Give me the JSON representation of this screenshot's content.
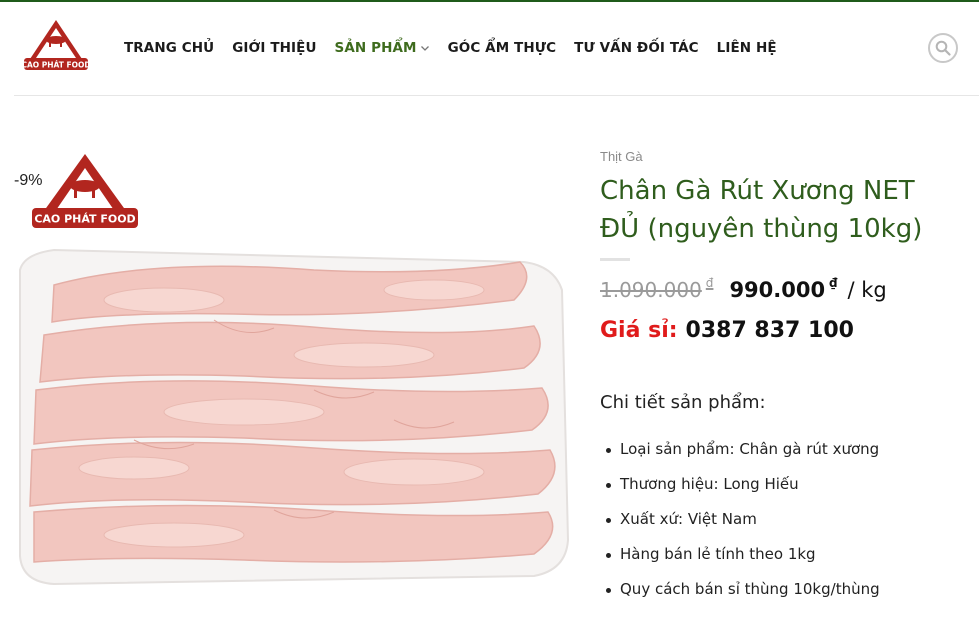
{
  "header": {
    "logo_text": "CAO PHÁT FOOD",
    "nav": [
      {
        "label": "TRANG CHỦ",
        "active": false
      },
      {
        "label": "GIỚI THIỆU",
        "active": false
      },
      {
        "label": "SẢN PHẨM",
        "active": true,
        "has_dropdown": true
      },
      {
        "label": "GÓC ẨM THỰC",
        "active": false
      },
      {
        "label": "TƯ VẤN ĐỐI TÁC",
        "active": false
      },
      {
        "label": "LIÊN HỆ",
        "active": false
      }
    ],
    "search_icon": "search-icon"
  },
  "product": {
    "sale_badge": "-9%",
    "badge_logo_text": "CAO PHÁT FOOD",
    "category": "Thịt Gà",
    "title": "Chân Gà Rút Xương NET ĐỦ (nguyên thùng 10kg)",
    "old_price": "1.090.000",
    "new_price": "990.000",
    "currency": "₫",
    "unit": "/ kg",
    "wholesale_label": "Giá sỉ:",
    "wholesale_phone": "0387 837 100",
    "details_heading": "Chi tiết sản phẩm:",
    "details": [
      "Loại sản phẩm: Chân gà rút xương",
      "Thương hiệu: Long Hiếu",
      "Xuất xứ: Việt Nam",
      "Hàng bán lẻ tính theo 1kg",
      "Quy cách bán sỉ thùng 10kg/thùng"
    ]
  },
  "colors": {
    "brand_green": "#2f5d1d",
    "nav_active": "#3e6b1d",
    "wholesale_red": "#e01b1b",
    "logo_red": "#b2261f"
  }
}
